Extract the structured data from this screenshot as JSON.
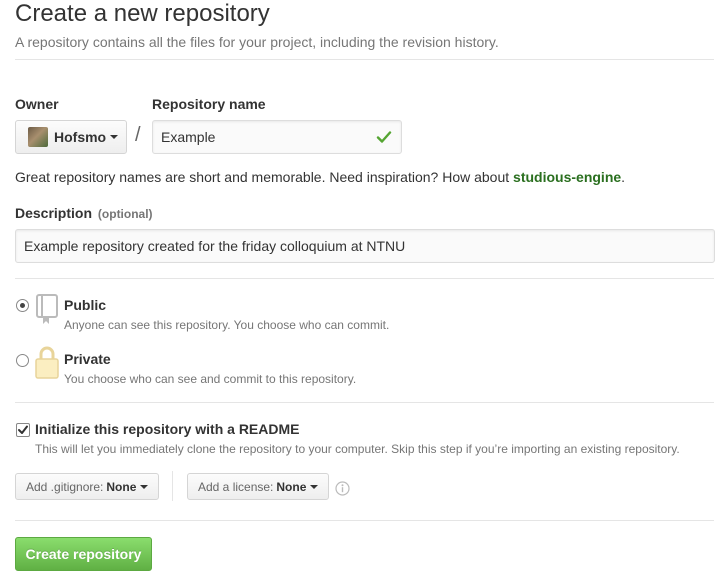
{
  "page": {
    "title": "Create a new repository",
    "subtitle": "A repository contains all the files for your project, including the revision history."
  },
  "owner": {
    "label": "Owner",
    "value": "Hofsmo",
    "separator": "/"
  },
  "repo_name": {
    "label": "Repository name",
    "value": "Example"
  },
  "name_hint": {
    "text": "Great repository names are short and memorable. Need inspiration? How about ",
    "suggestion": "studious-engine",
    "end": "."
  },
  "description": {
    "label": "Description",
    "optional": "(optional)",
    "value": "Example repository created for the friday colloquium at NTNU"
  },
  "visibility": {
    "public": {
      "label": "Public",
      "desc": "Anyone can see this repository. You choose who can commit.",
      "selected": true
    },
    "private": {
      "label": "Private",
      "desc": "You choose who can see and commit to this repository.",
      "selected": false
    }
  },
  "readme": {
    "label": "Initialize this repository with a README",
    "desc": "This will let you immediately clone the repository to your computer. Skip this step if you’re importing an existing repository.",
    "checked": true
  },
  "gitignore": {
    "prefix": "Add .gitignore:",
    "value": "None"
  },
  "license": {
    "prefix": "Add a license:",
    "value": "None"
  },
  "submit": {
    "label": "Create repository"
  },
  "colors": {
    "success": "#55a532",
    "button_green": "#60b044",
    "suggestion": "#2a6f1f"
  }
}
